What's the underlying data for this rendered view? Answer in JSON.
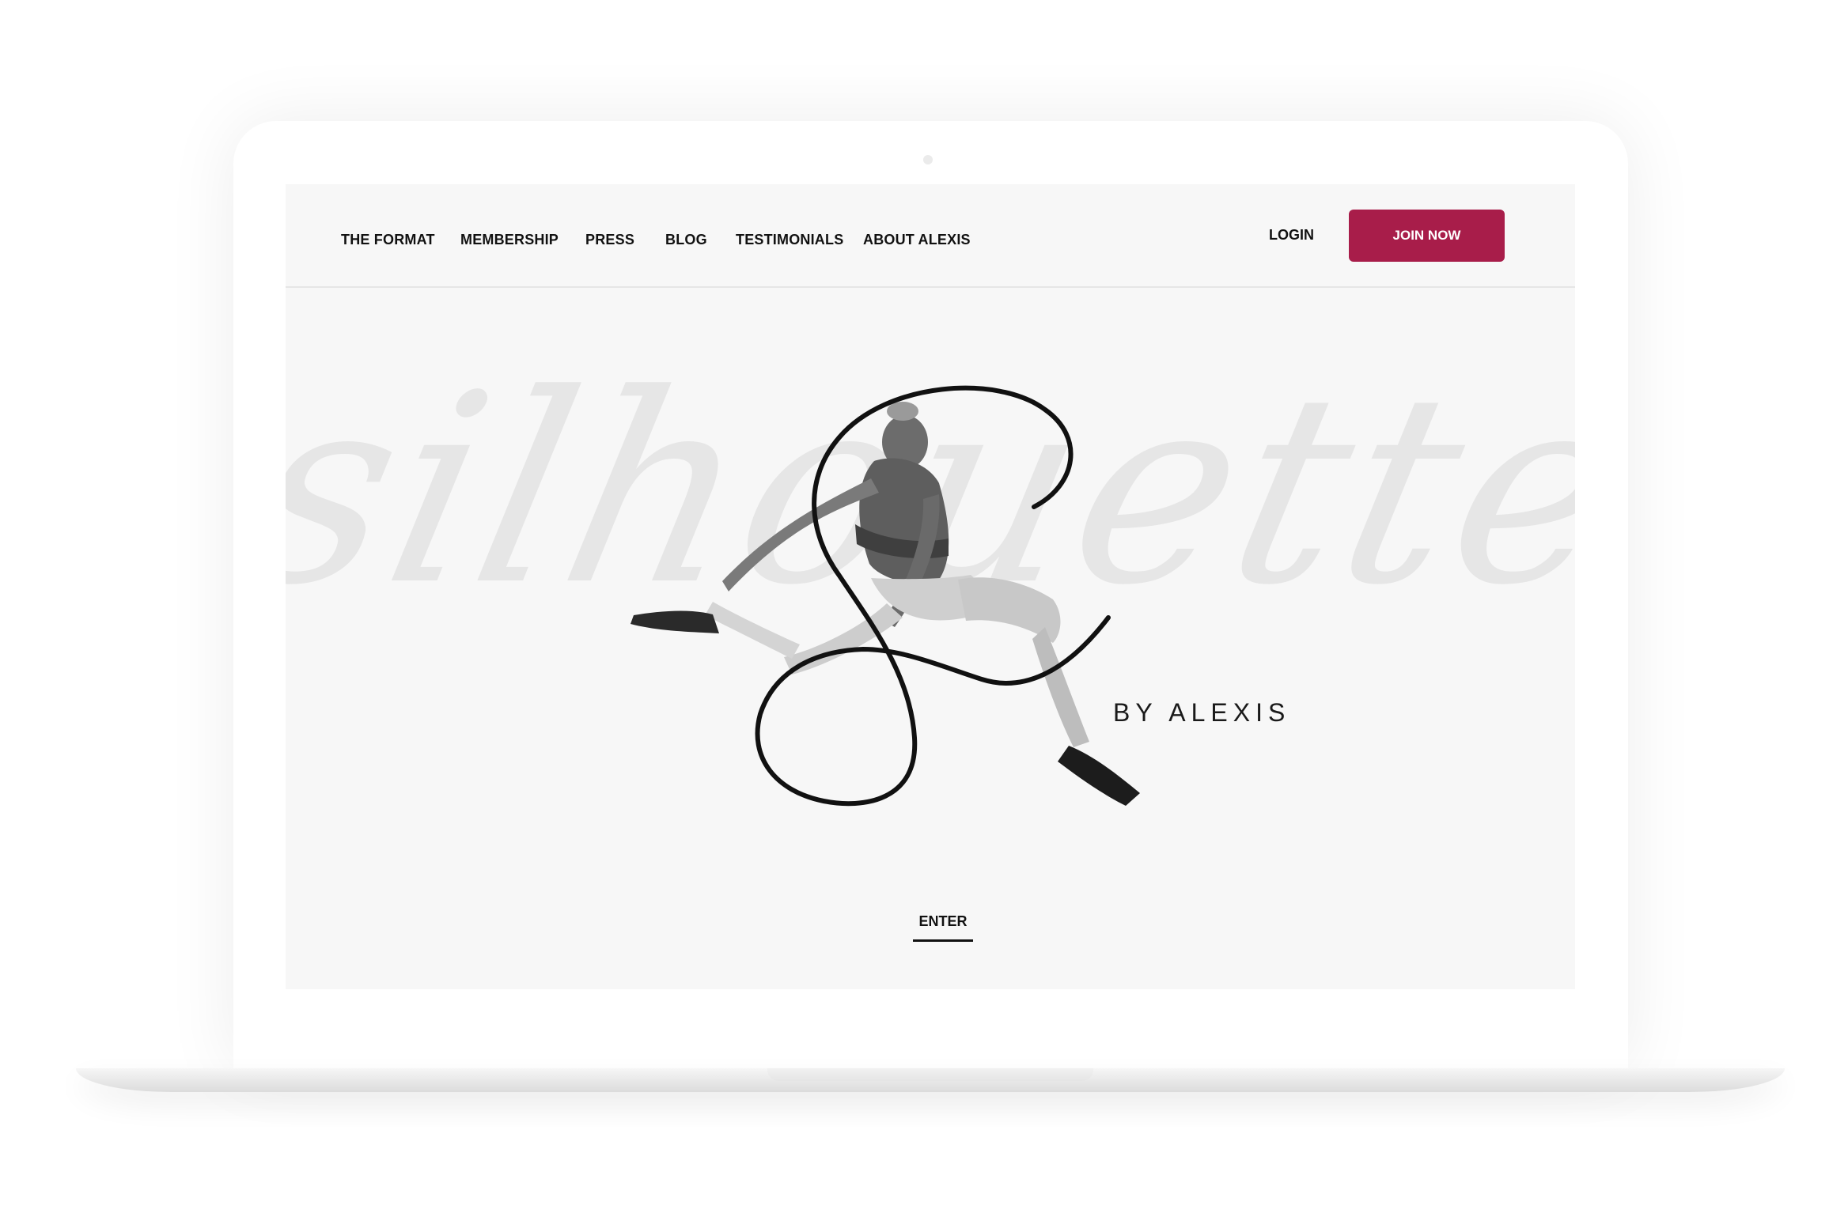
{
  "nav": {
    "items": [
      {
        "label": "THE FORMAT"
      },
      {
        "label": "MEMBERSHIP"
      },
      {
        "label": "PRESS"
      },
      {
        "label": "BLOG"
      },
      {
        "label": "TESTIMONIALS"
      },
      {
        "label": "ABOUT ALEXIS"
      }
    ],
    "login_label": "LOGIN",
    "join_label": "JOIN NOW"
  },
  "hero": {
    "watermark_text": "silhouette",
    "tagline": "BY ALEXIS",
    "enter_label": "ENTER"
  },
  "colors": {
    "accent": "#a81d4a",
    "screen_background": "#f7f7f7",
    "watermark": "#e6e6e6",
    "text": "#111111"
  },
  "icons": {
    "logo": "script-S-monogram",
    "photo": "jumping-athlete-silhouette"
  }
}
